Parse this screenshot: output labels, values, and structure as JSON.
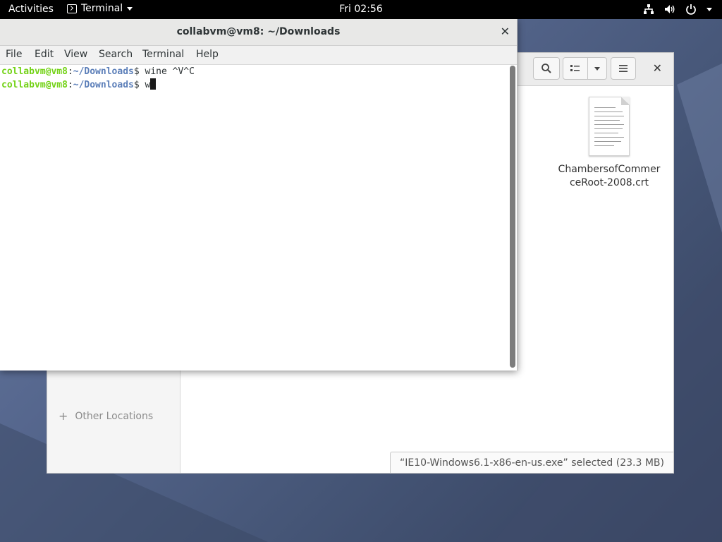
{
  "topbar": {
    "activities": "Activities",
    "app_name": "Terminal",
    "clock": "Fri 02:56"
  },
  "terminal": {
    "title": "collabvm@vm8: ~/Downloads",
    "menu": [
      "File",
      "Edit",
      "View",
      "Search",
      "Terminal",
      "Help"
    ],
    "lines": [
      {
        "user": "collabvm@vm8",
        "sep": ":",
        "path": "~/Downloads",
        "prompt": "$ ",
        "command": "wine ^V^C"
      },
      {
        "user": "collabvm@vm8",
        "sep": ":",
        "path": "~/Downloads",
        "prompt": "$ ",
        "command": "w"
      }
    ]
  },
  "files": {
    "sidebar": {
      "other_locations": "Other Locations"
    },
    "items": [
      {
        "name_line1": "ChambersofCommer",
        "name_line2": "ceRoot-2008.crt",
        "icon": "text-document-icon"
      }
    ],
    "status": "“IE10-Windows6.1-x86-en-us.exe” selected  (23.3 MB)"
  },
  "colors": {
    "prompt_user": "#73d216",
    "prompt_path": "#5c7fb9",
    "topbar": "#000000"
  }
}
